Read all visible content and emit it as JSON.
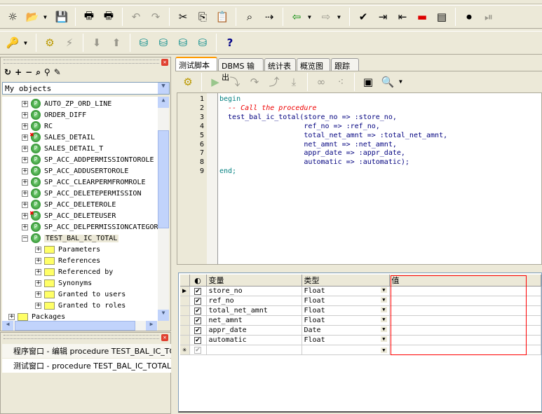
{
  "toolbar1": [
    "new-file",
    "open-folder",
    "save",
    "print",
    "print-preview",
    "undo",
    "redo",
    "cut",
    "copy",
    "paste",
    "find",
    "find-next",
    "go-back",
    "go-forward",
    "check-syntax",
    "indent",
    "unindent",
    "toggle-comment",
    "uncomment",
    "record-macro",
    "play-macro"
  ],
  "toolbar2": [
    "key",
    "compile",
    "break",
    "import",
    "export",
    "db-connect",
    "sql-connect",
    "db-find",
    "db-disconnect",
    "help"
  ],
  "browser": {
    "filter": "My objects",
    "items": [
      {
        "label": "AUTO_ZP_ORD_LINE",
        "error": false
      },
      {
        "label": "ORDER_DIFF",
        "error": false
      },
      {
        "label": "RC",
        "error": false
      },
      {
        "label": "SALES_DETAIL",
        "error": true
      },
      {
        "label": "SALES_DETAIL_T",
        "error": false
      },
      {
        "label": "SP_ACC_ADDPERMISSIONTOROLE",
        "error": false
      },
      {
        "label": "SP_ACC_ADDUSERTOROLE",
        "error": false
      },
      {
        "label": "SP_ACC_CLEARPERMFROMROLE",
        "error": false
      },
      {
        "label": "SP_ACC_DELETEPERMISSION",
        "error": false
      },
      {
        "label": "SP_ACC_DELETEROLE",
        "error": false
      },
      {
        "label": "SP_ACC_DELETEUSER",
        "error": true
      },
      {
        "label": "SP_ACC_DELPERMISSIONCATEGORY",
        "error": false
      },
      {
        "label": "TEST_BAL_IC_TOTAL",
        "error": false,
        "expanded": true
      }
    ],
    "children": [
      "Parameters",
      "References",
      "Referenced by",
      "Synonyms",
      "Granted to users",
      "Granted to roles"
    ],
    "packages": "Packages"
  },
  "windows": [
    "程序窗口 - 编辑 procedure TEST_BAL_IC_TOTAL",
    "测试窗口 - procedure TEST_BAL_IC_TOTAL"
  ],
  "tabs": [
    "测试脚本",
    "DBMS 输出",
    "统计表",
    "概览图",
    "跟踪"
  ],
  "code": {
    "l1": "begin",
    "l2": "  -- Call the procedure",
    "l3": "  test_bal_ic_total(store_no => :store_no,",
    "l4": "                    ref_no => :ref_no,",
    "l5": "                    total_net_amnt => :total_net_amnt,",
    "l6": "                    net_amnt => :net_amnt,",
    "l7": "                    appr_date => :appr_date,",
    "l8": "                    automatic => :automatic);",
    "l9": "end;"
  },
  "grid": {
    "headers": [
      "变量",
      "类型",
      "值"
    ],
    "rows": [
      {
        "name": "store_no",
        "type": "Float",
        "value": ""
      },
      {
        "name": "ref_no",
        "type": "Float",
        "value": ""
      },
      {
        "name": "total_net_amnt",
        "type": "Float",
        "value": ""
      },
      {
        "name": "net_amnt",
        "type": "Float",
        "value": ""
      },
      {
        "name": "appr_date",
        "type": "Date",
        "value": ""
      },
      {
        "name": "automatic",
        "type": "Float",
        "value": ""
      }
    ]
  },
  "colors": {
    "highlight_box": "#ff0000",
    "tab_accent": "#ff9900",
    "keyword": "#007f7f",
    "comment": "#ee0000"
  }
}
